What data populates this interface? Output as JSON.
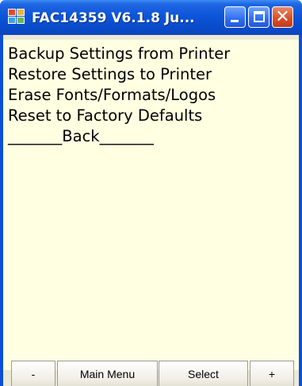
{
  "window": {
    "title": "FAC14359 V6.1.8 Ju...",
    "icon": "app-icon",
    "controls": [
      "minimize-icon",
      "maximize-icon",
      "close-icon"
    ]
  },
  "menu": {
    "items": [
      "Backup Settings from Printer",
      "Restore Settings to Printer",
      "Erase Fonts/Formats/Logos",
      "Reset to Factory Defaults",
      "_______Back_______"
    ]
  },
  "buttons": {
    "minus": "-",
    "main_menu": "Main Menu",
    "select": "Select",
    "plus": "+"
  },
  "colors": {
    "title_bar": "#0a4fd8",
    "menu_background": "#ffffe1",
    "close_button": "#d9502b"
  }
}
